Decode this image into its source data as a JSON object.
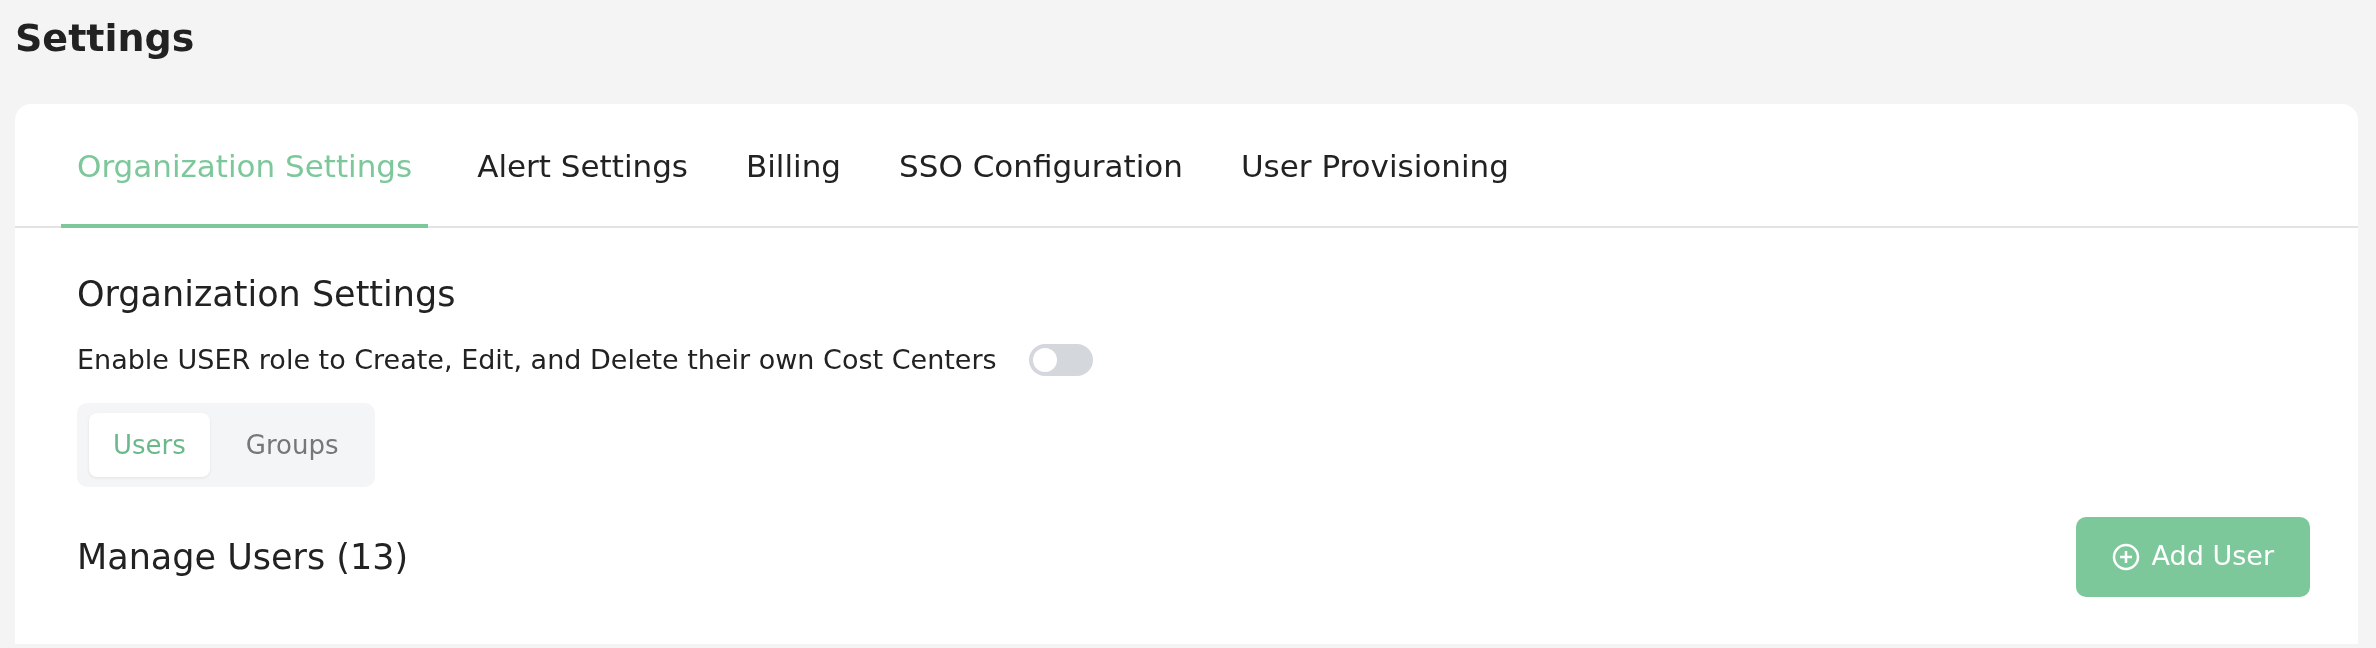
{
  "page_title": "Settings",
  "tabs": [
    {
      "label": "Organization Settings",
      "selected": true
    },
    {
      "label": "Alert Settings",
      "selected": false
    },
    {
      "label": "Billing",
      "selected": false
    },
    {
      "label": "SSO Configuration",
      "selected": false
    },
    {
      "label": "User Provisioning",
      "selected": false
    }
  ],
  "section_title": "Organization Settings",
  "setting": {
    "label": "Enable USER role to Create, Edit, and Delete their own Cost Centers",
    "on": false
  },
  "segments": [
    {
      "label": "Users",
      "selected": true
    },
    {
      "label": "Groups",
      "selected": false
    }
  ],
  "manage_title": "Manage Users (13)",
  "add_button": {
    "label": "Add User"
  }
}
